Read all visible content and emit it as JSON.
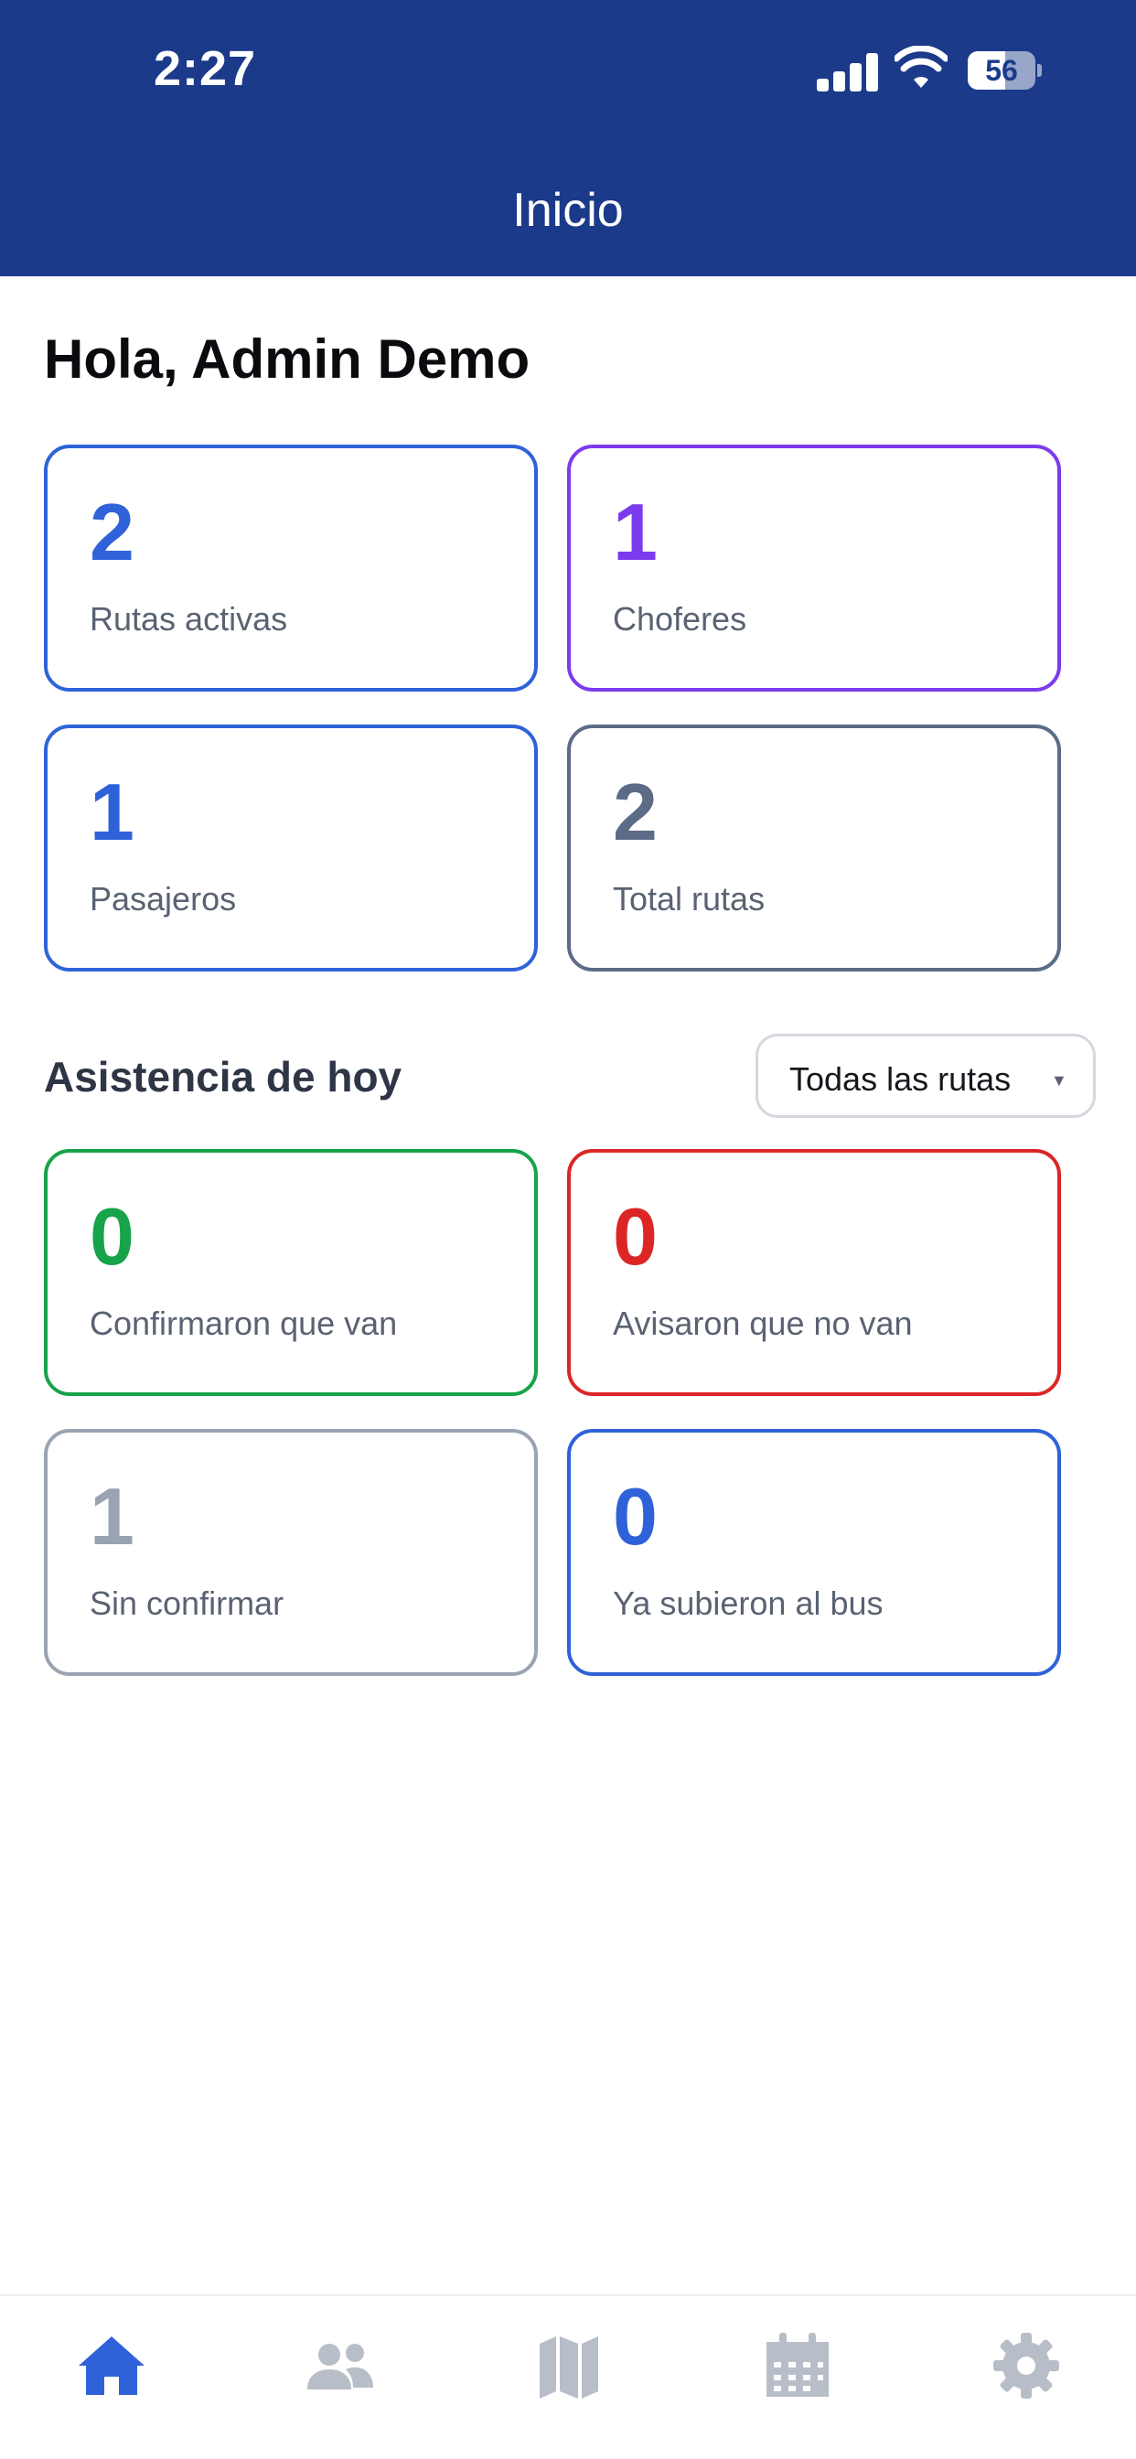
{
  "status_bar": {
    "time": "2:27",
    "battery_level": "56"
  },
  "header": {
    "title": "Inicio"
  },
  "greeting": "Hola, Admin Demo",
  "summary_cards": [
    {
      "value": "2",
      "label": "Rutas activas",
      "color": "#2f62d8"
    },
    {
      "value": "1",
      "label": "Choferes",
      "color": "#7c3aed"
    },
    {
      "value": "1",
      "label": "Pasajeros",
      "color": "#2f62d8"
    },
    {
      "value": "2",
      "label": "Total rutas",
      "color": "#5c6b86"
    }
  ],
  "attendance": {
    "title": "Asistencia de hoy",
    "filter": {
      "selected": "Todas las rutas"
    },
    "cards": [
      {
        "value": "0",
        "label": "Confirmaron que van",
        "color": "#16a34a"
      },
      {
        "value": "0",
        "label": "Avisaron que no van",
        "color": "#dc2626"
      },
      {
        "value": "1",
        "label": "Sin confirmar",
        "color": "#9aa3b2"
      },
      {
        "value": "0",
        "label": "Ya subieron al bus",
        "color": "#2f62d8"
      }
    ]
  },
  "tab_bar": {
    "active_color": "#2f62d8",
    "inactive_color": "#b8bec8",
    "tabs": [
      {
        "icon": "home-icon",
        "active": true
      },
      {
        "icon": "users-icon",
        "active": false
      },
      {
        "icon": "map-icon",
        "active": false
      },
      {
        "icon": "calendar-icon",
        "active": false
      },
      {
        "icon": "gear-icon",
        "active": false
      }
    ]
  }
}
